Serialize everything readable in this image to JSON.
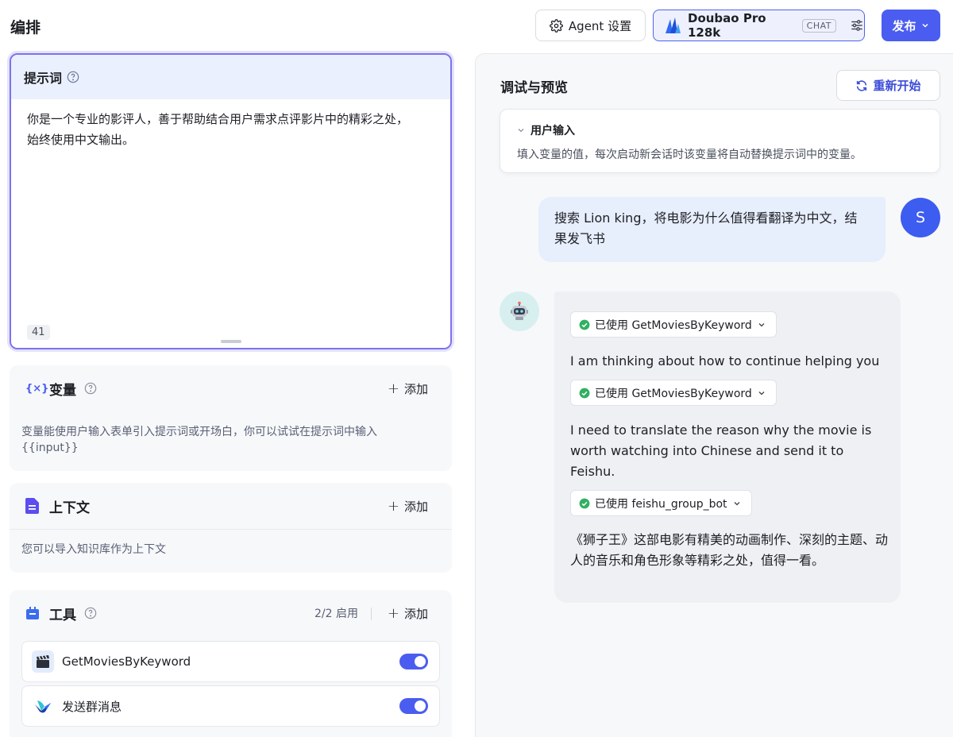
{
  "header": {
    "title": "编排",
    "agent_settings_label": "Agent 设置",
    "model_name": "Doubao Pro 128k",
    "model_tag": "CHAT",
    "publish_label": "发布"
  },
  "prompt": {
    "title": "提示词",
    "text": "你是一个专业的影评人，善于帮助结合用户需求点评影片中的精彩之处，始终使用中文输出。",
    "char_count": "41"
  },
  "variables": {
    "title": "变量",
    "add_label": "添加",
    "description": "变量能使用户输入表单引入提示词或开场白，你可以试试在提示词中输入{{input}}"
  },
  "context": {
    "title": "上下文",
    "add_label": "添加",
    "description": "您可以导入知识库作为上下文"
  },
  "tools": {
    "title": "工具",
    "count_label": "2/2 启用",
    "add_label": "添加",
    "items": [
      {
        "name": "GetMoviesByKeyword",
        "enabled": true,
        "icon": "clapperboard-icon"
      },
      {
        "name": "发送群消息",
        "enabled": true,
        "icon": "feishu-icon"
      }
    ]
  },
  "debug": {
    "title": "调试与预览",
    "restart_label": "重新开始",
    "user_input": {
      "title": "用户输入",
      "description": "填入变量的值，每次启动新会话时该变量将自动替换提示词中的变量。"
    },
    "messages": {
      "user": {
        "avatar_letter": "S",
        "text": "搜索 Lion king，将电影为什么值得看翻译为中文，结果发飞书"
      },
      "bot": {
        "chip1": "已使用 GetMoviesByKeyword",
        "text1": "I am thinking about how to continue helping you",
        "chip2": "已使用 GetMoviesByKeyword",
        "text2": "I need to translate the reason why the movie is worth watching into Chinese and send it to Feishu.",
        "chip3": "已使用 feishu_group_bot",
        "text3": "《狮子王》这部电影有精美的动画制作、深刻的主题、动人的音乐和角色形象等精彩之处，值得一看。"
      }
    }
  },
  "colors": {
    "accent": "#4a5df0",
    "success": "#2fb062",
    "prompt_border": "#7c72ef"
  }
}
